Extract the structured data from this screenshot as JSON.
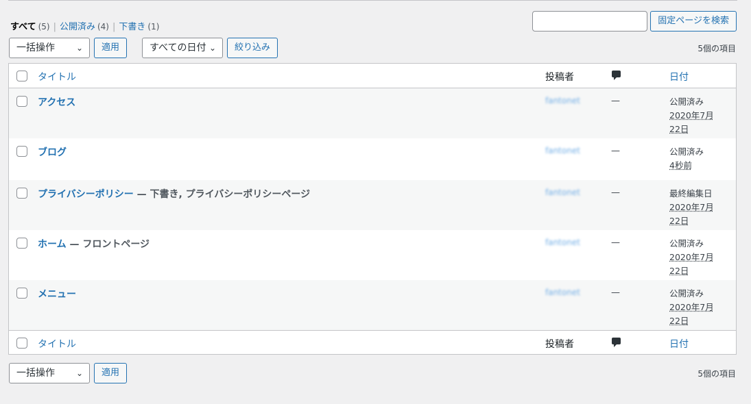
{
  "filters": [
    {
      "label": "すべて",
      "count": "(5)"
    },
    {
      "label": "公開済み",
      "count": "(4)"
    },
    {
      "label": "下書き",
      "count": "(1)"
    }
  ],
  "filter_separator": "|",
  "search": {
    "button_label": "固定ページを検索",
    "value": ""
  },
  "tablenav_top": {
    "bulk_action": "一括操作",
    "apply": "適用",
    "date_filter": "すべての日付",
    "filter_button": "絞り込み",
    "items_count": "5個の項目"
  },
  "tablenav_bottom": {
    "bulk_action": "一括操作",
    "apply": "適用",
    "items_count": "5個の項目"
  },
  "columns": {
    "title": "タイトル",
    "author": "投稿者",
    "comments_icon": "comment-icon",
    "date": "日付"
  },
  "rows": [
    {
      "title": "アクセス",
      "state": "",
      "author": "fantonet",
      "comments": "—",
      "date_status": "公開済み",
      "date_value": "2020年7月22日"
    },
    {
      "title": "ブログ",
      "state": "",
      "author": "fantonet",
      "comments": "—",
      "date_status": "公開済み",
      "date_value": "4秒前"
    },
    {
      "title": "プライバシーポリシー",
      "state": " — 下書き, プライバシーポリシーページ",
      "author": "fantonet",
      "comments": "—",
      "date_status": "最終編集日",
      "date_value": "2020年7月22日"
    },
    {
      "title": "ホーム",
      "state": " — フロントページ",
      "author": "fantonet",
      "comments": "—",
      "date_status": "公開済み",
      "date_value": "2020年7月22日"
    },
    {
      "title": "メニュー",
      "state": "",
      "author": "fantonet",
      "comments": "—",
      "date_status": "公開済み",
      "date_value": "2020年7月22日"
    }
  ],
  "colors": {
    "link": "#2271b1",
    "background": "#f0f0f1",
    "border": "#c3c4c7"
  }
}
